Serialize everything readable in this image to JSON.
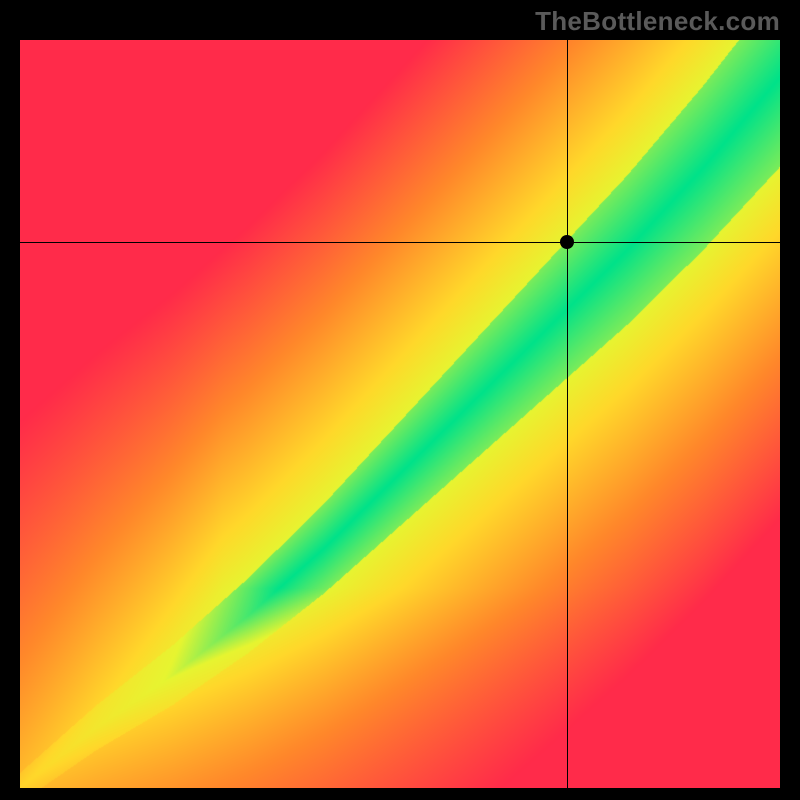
{
  "brand": "TheBottleneck.com",
  "chart_data": {
    "type": "heatmap",
    "title": "",
    "xlabel": "",
    "ylabel": "",
    "x_range": [
      0,
      100
    ],
    "y_range": [
      0,
      100
    ],
    "grid": false,
    "legend": false,
    "crosshair": {
      "x": 72,
      "y": 73
    },
    "marker": {
      "x": 72,
      "y": 73
    },
    "ridge": {
      "description": "Optimal diagonal band (green) through red-orange-yellow field",
      "points_xy": [
        [
          0,
          0
        ],
        [
          10,
          8
        ],
        [
          20,
          15
        ],
        [
          30,
          23
        ],
        [
          40,
          32
        ],
        [
          50,
          42
        ],
        [
          60,
          52
        ],
        [
          70,
          62
        ],
        [
          80,
          72
        ],
        [
          90,
          83
        ],
        [
          100,
          95
        ]
      ],
      "band_halfwidth_start": 2,
      "band_halfwidth_end": 12
    },
    "color_scale": {
      "0.00": "#ff2b4a",
      "0.40": "#ff8a2a",
      "0.70": "#ffd92a",
      "0.85": "#e7f531",
      "1.00": "#00e28a"
    }
  }
}
